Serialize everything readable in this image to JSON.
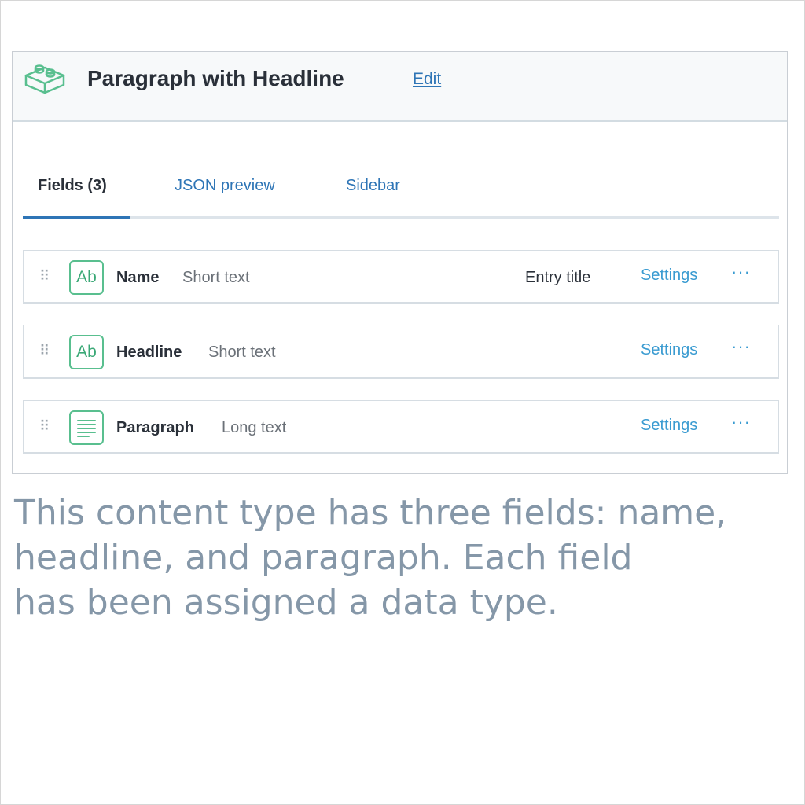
{
  "header": {
    "title": "Paragraph with Headline",
    "edit_label": "Edit",
    "icon": "content-type-block-icon"
  },
  "tabs": [
    {
      "label": "Fields (3)",
      "active": true
    },
    {
      "label": "JSON preview",
      "active": false
    },
    {
      "label": "Sidebar",
      "active": false
    }
  ],
  "fields": [
    {
      "name": "Name",
      "type": "Short text",
      "badge": "Entry title",
      "settings_label": "Settings",
      "icon": "Ab",
      "more": "···"
    },
    {
      "name": "Headline",
      "type": "Short text",
      "settings_label": "Settings",
      "icon": "Ab",
      "more": "···"
    },
    {
      "name": "Paragraph",
      "type": "Long text",
      "settings_label": "Settings",
      "icon": "long-text-icon",
      "more": "···"
    }
  ],
  "caption": {
    "line1": "This content type has three fields: name,",
    "line2": "headline, and paragraph. Each field",
    "line3": "has been assigned a data type."
  },
  "colors": {
    "accent": "#2e75b6",
    "link": "#3a9bd1",
    "icon_green": "#59bf8f",
    "caption": "#8597a8"
  }
}
